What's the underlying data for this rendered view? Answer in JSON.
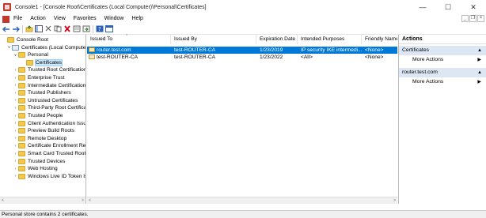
{
  "window": {
    "title": "Console1 - [Console Root\\Certificates (Local Computer)\\Personal\\Certificates]",
    "minimize": "—",
    "maximize": "☐",
    "close": "✕"
  },
  "menu": {
    "items": [
      "File",
      "Action",
      "View",
      "Favorites",
      "Window",
      "Help"
    ],
    "mdi": [
      "_",
      "❐",
      "×"
    ]
  },
  "toolbar": {
    "buttons": [
      "back-icon",
      "forward-icon",
      "up-folder-icon",
      "show-hide-tree-icon",
      "cut-icon",
      "copy-icon",
      "delete-icon",
      "properties-icon",
      "export-icon",
      "help-icon",
      "console-view-icon"
    ]
  },
  "tree": {
    "items": [
      {
        "label": "Console Root",
        "level": 0,
        "expander": "",
        "icon": "folder"
      },
      {
        "label": "Certificates (Local Computer)",
        "level": 1,
        "expander": "∨",
        "icon": "cert"
      },
      {
        "label": "Personal",
        "level": 2,
        "expander": "∨",
        "icon": "folder"
      },
      {
        "label": "Certificates",
        "level": 3,
        "expander": "",
        "icon": "folder",
        "selected": true
      },
      {
        "label": "Trusted Root Certification Authorities",
        "level": 2,
        "expander": "›",
        "icon": "folder"
      },
      {
        "label": "Enterprise Trust",
        "level": 2,
        "expander": "›",
        "icon": "folder"
      },
      {
        "label": "Intermediate Certification Authorities",
        "level": 2,
        "expander": "›",
        "icon": "folder"
      },
      {
        "label": "Trusted Publishers",
        "level": 2,
        "expander": "›",
        "icon": "folder"
      },
      {
        "label": "Untrusted Certificates",
        "level": 2,
        "expander": "›",
        "icon": "folder"
      },
      {
        "label": "Third-Party Root Certification Authorities",
        "level": 2,
        "expander": "›",
        "icon": "folder"
      },
      {
        "label": "Trusted People",
        "level": 2,
        "expander": "›",
        "icon": "folder"
      },
      {
        "label": "Client Authentication Issuers",
        "level": 2,
        "expander": "›",
        "icon": "folder"
      },
      {
        "label": "Preview Build Roots",
        "level": 2,
        "expander": "›",
        "icon": "folder"
      },
      {
        "label": "Remote Desktop",
        "level": 2,
        "expander": "›",
        "icon": "folder"
      },
      {
        "label": "Certificate Enrollment Requests",
        "level": 2,
        "expander": "›",
        "icon": "folder"
      },
      {
        "label": "Smart Card Trusted Roots",
        "level": 2,
        "expander": "›",
        "icon": "folder"
      },
      {
        "label": "Trusted Devices",
        "level": 2,
        "expander": "›",
        "icon": "folder"
      },
      {
        "label": "Web Hosting",
        "level": 2,
        "expander": "›",
        "icon": "folder"
      },
      {
        "label": "Windows Live ID Token Issuer",
        "level": 2,
        "expander": "›",
        "icon": "folder"
      }
    ],
    "scroll_left": "<",
    "scroll_right": ">"
  },
  "list": {
    "columns": [
      "Issued To",
      "Issued By",
      "Expiration Date",
      "Intended Purposes",
      "Friendly Name"
    ],
    "rows": [
      {
        "issued_to": "router.test.com",
        "issued_by": "test-ROUTER-CA",
        "expiration": "1/23/2019",
        "purposes": "IP security IKE intermedi...",
        "friendly": "<None>",
        "selected": true
      },
      {
        "issued_to": "test-ROUTER-CA",
        "issued_by": "test-ROUTER-CA",
        "expiration": "1/23/2022",
        "purposes": "<All>",
        "friendly": "<None>",
        "selected": false
      }
    ],
    "scroll_left": "<",
    "scroll_right": ">"
  },
  "actions": {
    "title": "Actions",
    "sections": [
      {
        "label": "Certificates",
        "caret": "▲",
        "items": [
          {
            "label": "More Actions",
            "arrow": "▶"
          }
        ]
      },
      {
        "label": "router.test.com",
        "caret": "▲",
        "items": [
          {
            "label": "More Actions",
            "arrow": "▶"
          }
        ]
      }
    ]
  },
  "status": {
    "text": "Personal store contains 2 certificates."
  }
}
